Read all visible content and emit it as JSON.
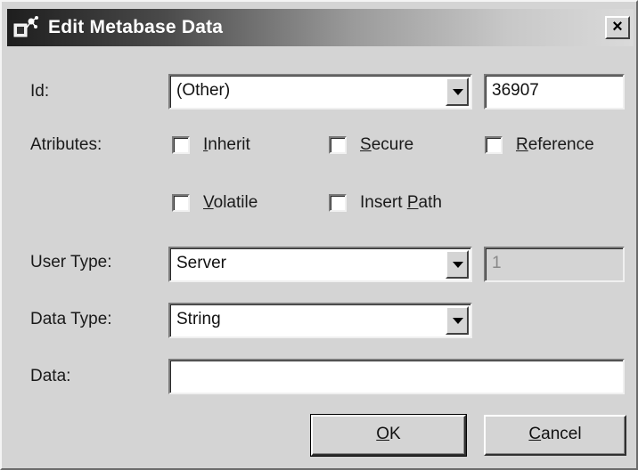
{
  "window": {
    "title": "Edit Metabase Data",
    "close_glyph": "×"
  },
  "labels": {
    "id": "Id:",
    "attributes": "Atributes:",
    "user_type": "User Type:",
    "data_type": "Data Type:",
    "data": "Data:"
  },
  "fields": {
    "id_select": "(Other)",
    "id_value": "36907",
    "user_type_select": "Server",
    "user_type_value": "1",
    "data_type_select": "String",
    "data_value": ""
  },
  "attributes": [
    {
      "key": "I",
      "rest": "nherit",
      "checked": false
    },
    {
      "key": "S",
      "rest": "ecure",
      "checked": false
    },
    {
      "key": "R",
      "rest": "eference",
      "checked": false
    },
    {
      "key": "V",
      "rest": "olatile",
      "checked": false
    },
    {
      "pre": "Insert ",
      "key": "P",
      "rest": "ath",
      "checked": false
    }
  ],
  "buttons": {
    "ok_key": "O",
    "ok_rest": "K",
    "cancel_key": "C",
    "cancel_rest": "ancel"
  },
  "icons": {
    "title": "metabase-app-icon"
  }
}
